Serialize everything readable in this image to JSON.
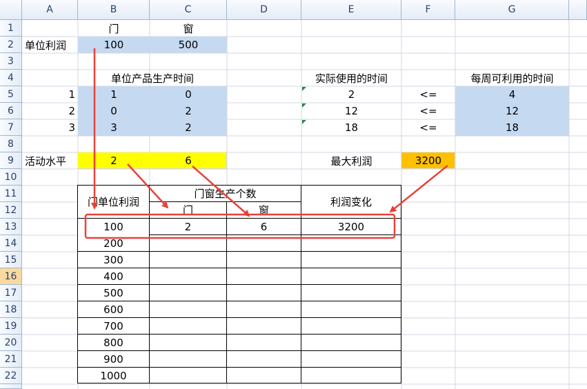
{
  "columns": [
    "A",
    "B",
    "C",
    "D",
    "E",
    "F",
    "G"
  ],
  "rows": [
    "1",
    "2",
    "3",
    "4",
    "5",
    "6",
    "7",
    "8",
    "9",
    "10",
    "11",
    "12",
    "13",
    "14",
    "15",
    "16",
    "17",
    "18",
    "19",
    "20",
    "21",
    "22"
  ],
  "active_row": "16",
  "r1": {
    "b": "门",
    "c": "窗"
  },
  "r2": {
    "a": "单位利润",
    "b": "100",
    "c": "500"
  },
  "r4": {
    "b": "单位产品生产时间",
    "e": "实际使用的时间",
    "g": "每周可利用的时间"
  },
  "r5": {
    "a": "1",
    "b": "1",
    "c": "0",
    "e": "2",
    "f": "<=",
    "g": "4"
  },
  "r6": {
    "a": "2",
    "b": "0",
    "c": "2",
    "e": "12",
    "f": "<=",
    "g": "12"
  },
  "r7": {
    "a": "3",
    "b": "3",
    "c": "2",
    "e": "18",
    "f": "<=",
    "g": "18"
  },
  "r9": {
    "a": "活动水平",
    "b": "2",
    "c": "6",
    "e": "最大利润",
    "f": "3200"
  },
  "table": {
    "h_unit_profit": "门单位利润",
    "h_count": "门窗生产个数",
    "h_men": "门",
    "h_chuang": "窗",
    "h_change": "利润变化",
    "row13": {
      "b": "100",
      "c": "2",
      "d": "6",
      "e": "3200"
    },
    "profits": [
      "200",
      "300",
      "400",
      "500",
      "600",
      "700",
      "800",
      "900",
      "1000"
    ]
  },
  "colors": {
    "blue_fill": "#c5d9f1",
    "yellow_fill": "#ffff00",
    "orange_fill": "#ffc000",
    "annotation_red": "#e8413a"
  }
}
